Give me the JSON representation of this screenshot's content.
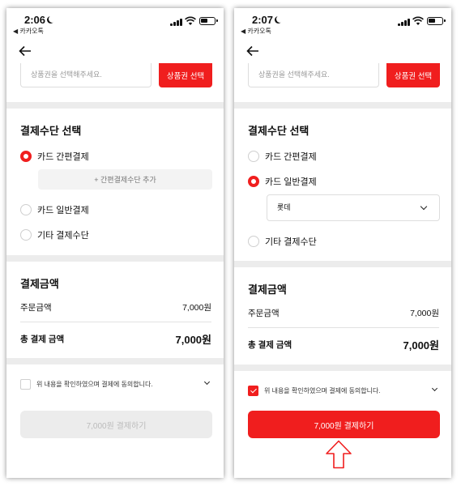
{
  "colors": {
    "accent": "#f01e1e",
    "divider": "#ececec",
    "disabled": "#ececec"
  },
  "screens": {
    "left": {
      "status": {
        "time": "2:06",
        "back_app": "◀ 카카오톡"
      },
      "voucher": {
        "placeholder": "상품권을 선택해주세요.",
        "button": "상품권 선택"
      },
      "payment_method": {
        "title": "결제수단 선택",
        "options": [
          {
            "label": "카드 간편결제",
            "selected": true
          },
          {
            "label": "카드 일반결제",
            "selected": false
          },
          {
            "label": "기타 결제수단",
            "selected": false
          }
        ],
        "add_button": "+ 간편결제수단 추가"
      },
      "amount": {
        "title": "결제금액",
        "order_label": "주문금액",
        "order_value": "7,000원",
        "total_label": "총 결제 금액",
        "total_value": "7,000원"
      },
      "agreement": {
        "text": "위 내용을 확인하였으며 결제에 동의합니다.",
        "checked": false
      },
      "pay_button": {
        "label": "7,000원 결제하기",
        "enabled": false
      }
    },
    "right": {
      "status": {
        "time": "2:07",
        "back_app": "◀ 카카오톡"
      },
      "voucher": {
        "placeholder": "상품권을 선택해주세요.",
        "button": "상품권 선택"
      },
      "payment_method": {
        "title": "결제수단 선택",
        "options": [
          {
            "label": "카드 간편결제",
            "selected": false
          },
          {
            "label": "카드 일반결제",
            "selected": true
          },
          {
            "label": "기타 결제수단",
            "selected": false
          }
        ],
        "card_select": "롯데"
      },
      "amount": {
        "title": "결제금액",
        "order_label": "주문금액",
        "order_value": "7,000원",
        "total_label": "총 결제 금액",
        "total_value": "7,000원"
      },
      "agreement": {
        "text": "위 내용을 확인하였으며 결제에 동의합니다.",
        "checked": true
      },
      "pay_button": {
        "label": "7,000원 결제하기",
        "enabled": true
      }
    }
  },
  "icons": {
    "back": "arrow-left-icon",
    "moon": "moon-icon",
    "signal": "signal-icon",
    "wifi": "wifi-icon",
    "battery": "battery-icon",
    "dropdown": "chevron-down-icon",
    "annotation": "arrow-up-outline-icon"
  }
}
